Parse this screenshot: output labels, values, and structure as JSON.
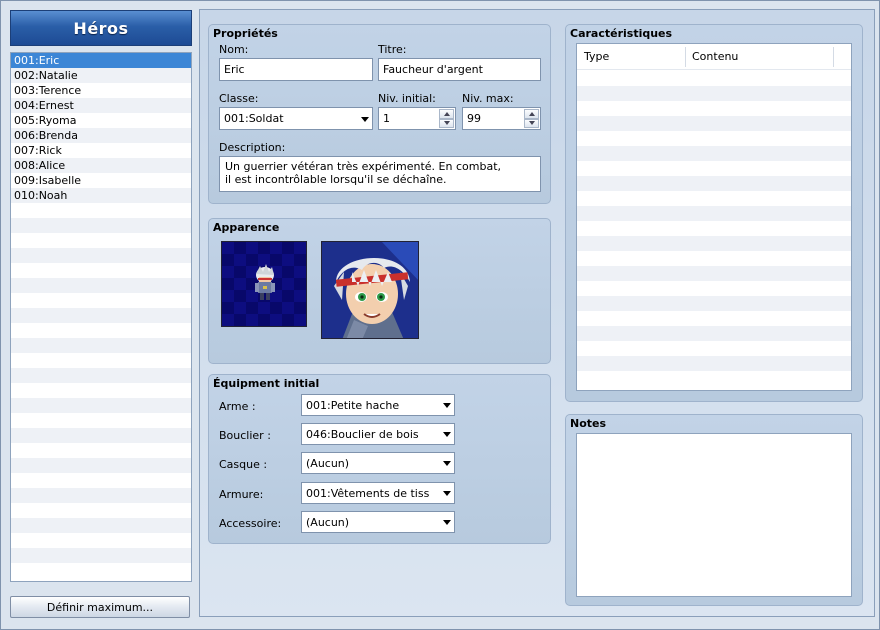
{
  "sidebar": {
    "title": "Héros",
    "heroes": [
      {
        "label": "001:Eric",
        "selected": true
      },
      {
        "label": "002:Natalie",
        "selected": false
      },
      {
        "label": "003:Terence",
        "selected": false
      },
      {
        "label": "004:Ernest",
        "selected": false
      },
      {
        "label": "005:Ryoma",
        "selected": false
      },
      {
        "label": "006:Brenda",
        "selected": false
      },
      {
        "label": "007:Rick",
        "selected": false
      },
      {
        "label": "008:Alice",
        "selected": false
      },
      {
        "label": "009:Isabelle",
        "selected": false
      },
      {
        "label": "010:Noah",
        "selected": false
      }
    ],
    "max_button": "Définir maximum..."
  },
  "properties": {
    "title": "Propriétés",
    "name_label": "Nom:",
    "name_value": "Eric",
    "nickname_label": "Titre:",
    "nickname_value": "Faucheur d'argent",
    "class_label": "Classe:",
    "class_value": "001:Soldat",
    "initial_level_label": "Niv. initial:",
    "initial_level_value": "1",
    "max_level_label": "Niv. max:",
    "max_level_value": "99",
    "description_label": "Description:",
    "description_line1": "Un guerrier vétéran très expérimenté. En combat,",
    "description_line2": "il est incontrôlable lorsqu'il se déchaîne."
  },
  "appearance": {
    "title": "Apparence"
  },
  "equipment": {
    "title": "Équipment initial",
    "weapon_label": "Arme :",
    "weapon_value": "001:Petite hache",
    "shield_label": "Bouclier :",
    "shield_value": "046:Bouclier de bois",
    "helmet_label": "Casque :",
    "helmet_value": "(Aucun)",
    "armor_label": "Armure:",
    "armor_value": "001:Vêtements de tiss",
    "accessory_label": "Accessoire:",
    "accessory_value": "(Aucun)"
  },
  "traits": {
    "title": "Caractéristiques",
    "col_type": "Type",
    "col_content": "Contenu"
  },
  "notes": {
    "title": "Notes"
  },
  "colors": {
    "selection": "#3c86d6",
    "header_blue": "#2a5ea8"
  }
}
